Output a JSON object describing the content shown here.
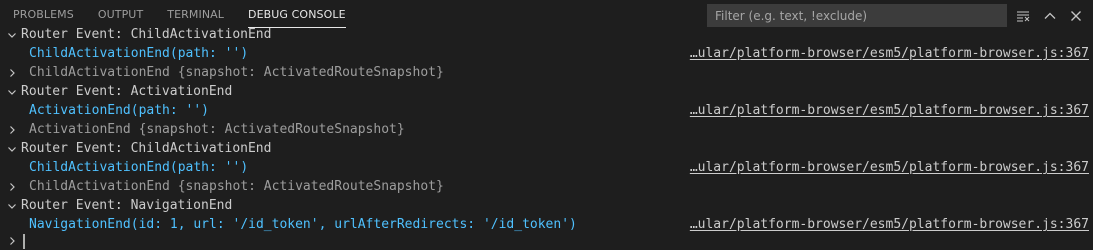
{
  "tabs": [
    {
      "label": "PROBLEMS",
      "active": false
    },
    {
      "label": "OUTPUT",
      "active": false
    },
    {
      "label": "TERMINAL",
      "active": false
    },
    {
      "label": "DEBUG CONSOLE",
      "active": true
    }
  ],
  "filter": {
    "placeholder": "Filter (e.g. text, !exclude)",
    "value": ""
  },
  "header_icons": [
    "clear-console-icon",
    "chevron-up-icon",
    "close-icon"
  ],
  "console": {
    "lines": [
      {
        "kind": "group",
        "text": "Router Event: ChildActivationEnd",
        "source": ""
      },
      {
        "kind": "event",
        "text": "ChildActivationEnd(path: '')",
        "source": "…ular/platform-browser/esm5/platform-browser.js:367"
      },
      {
        "kind": "snapshot",
        "text": "ChildActivationEnd {snapshot: ActivatedRouteSnapshot}",
        "source": ""
      },
      {
        "kind": "group",
        "text": "Router Event: ActivationEnd",
        "source": ""
      },
      {
        "kind": "event",
        "text": "ActivationEnd(path: '')",
        "source": "…ular/platform-browser/esm5/platform-browser.js:367"
      },
      {
        "kind": "snapshot",
        "text": "ActivationEnd {snapshot: ActivatedRouteSnapshot}",
        "source": ""
      },
      {
        "kind": "group",
        "text": "Router Event: ChildActivationEnd",
        "source": ""
      },
      {
        "kind": "event",
        "text": "ChildActivationEnd(path: '')",
        "source": "…ular/platform-browser/esm5/platform-browser.js:367"
      },
      {
        "kind": "snapshot",
        "text": "ChildActivationEnd {snapshot: ActivatedRouteSnapshot}",
        "source": ""
      },
      {
        "kind": "group",
        "text": "Router Event: NavigationEnd",
        "source": ""
      },
      {
        "kind": "event",
        "text": "NavigationEnd(id: 1, url: '/id_token', urlAfterRedirects: '/id_token')",
        "source": "…ular/platform-browser/esm5/platform-browser.js:367"
      }
    ]
  },
  "colors": {
    "background": "#1e1e1e",
    "event_text": "#4fc1ff",
    "snapshot_text": "#9d9d9d",
    "input_background": "#3c3c3c"
  }
}
